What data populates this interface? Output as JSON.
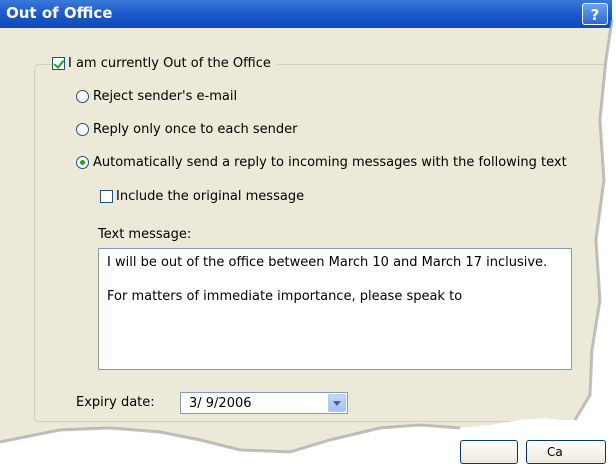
{
  "window": {
    "title": "Out of Office",
    "help": "?"
  },
  "out_of_office": {
    "label": "I am currently Out of the Office",
    "checked": true
  },
  "options": [
    {
      "label": "Reject sender's e-mail",
      "selected": false
    },
    {
      "label": "Reply only once to each sender",
      "selected": false
    },
    {
      "label": "Automatically send a reply to incoming messages with the following text",
      "selected": true
    }
  ],
  "include_original": {
    "label": "Include the original message",
    "checked": false
  },
  "text_message": {
    "label": "Text message:",
    "lines": [
      "I will be out of the office between March 10 and March 17 inclusive.",
      "For matters of immediate importance, please speak to"
    ]
  },
  "expiry": {
    "label": "Expiry date:",
    "value": "3/ 9/2006"
  },
  "buttons": {
    "cancel_partial": "Ca"
  },
  "colors": {
    "titlebar": "#1c5ccf",
    "dialog_bg": "#ece9d8",
    "check_green": "#21a121"
  }
}
